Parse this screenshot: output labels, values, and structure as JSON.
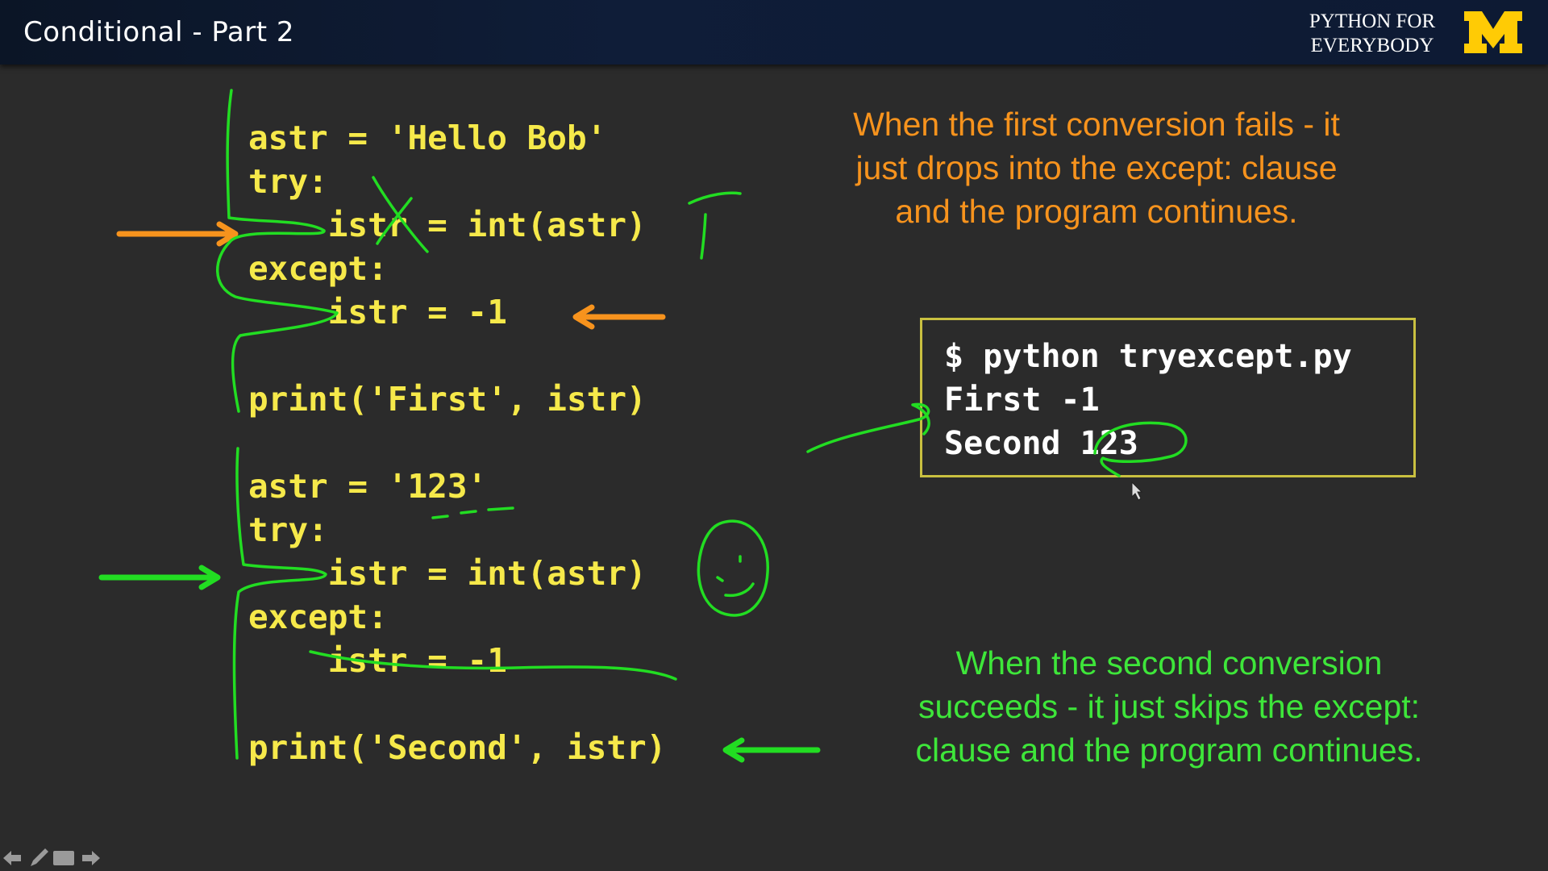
{
  "header": {
    "title": "Conditional - Part 2",
    "brand_line1": "PYTHON FOR",
    "brand_line2": "EVERYBODY",
    "logo_letter": "M"
  },
  "code_block_1": {
    "line1": "astr = 'Hello Bob'",
    "line2": "try:",
    "line3": "    istr = int(astr)",
    "line4": "except:",
    "line5": "    istr = -1",
    "line6": "print('First', istr)"
  },
  "code_block_2": {
    "line1": "astr = '123'",
    "line2": "try:",
    "line3": "    istr = int(astr)",
    "line4": "except:",
    "line5": "    istr = -1",
    "line6": "print('Second', istr)"
  },
  "notes": {
    "first": {
      "line1": "When the first conversion fails - it",
      "line2": "just drops into the except: clause",
      "line3": "and the program continues."
    },
    "second": {
      "line1": "When the second conversion",
      "line2": "succeeds - it just skips the except:",
      "line3": "clause and the program continues."
    }
  },
  "terminal": {
    "line1": "$ python tryexcept.py",
    "line2": "First -1",
    "line3": "Second 123"
  },
  "colors": {
    "code": "#f6e94a",
    "orange": "#f7931d",
    "green": "#3ee63a",
    "header_bg": "#0f1d38",
    "slide_bg": "#2b2b2b",
    "logo": "#ffcb05"
  },
  "icons": [
    "left-arrow-icon",
    "pen-icon",
    "menu-icon",
    "right-arrow-icon"
  ]
}
